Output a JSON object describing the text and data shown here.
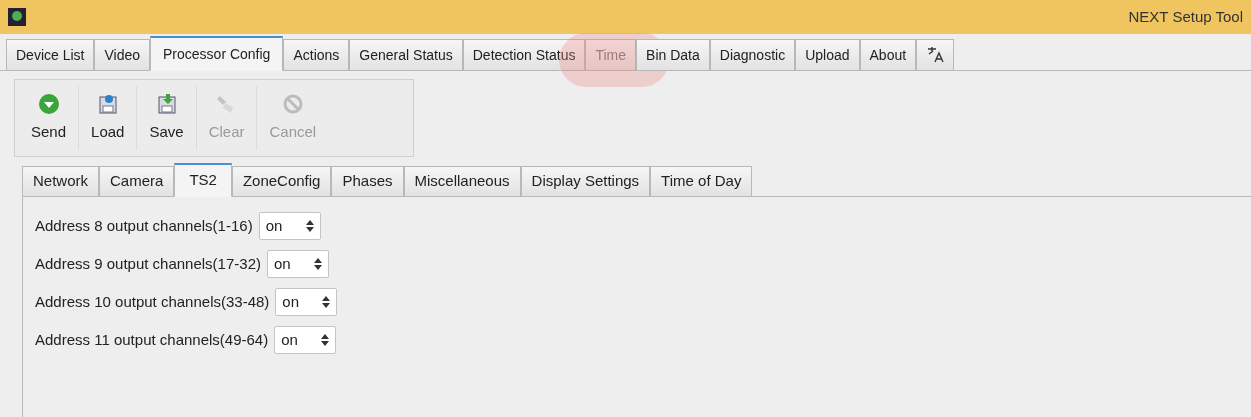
{
  "window": {
    "title": "NEXT Setup Tool"
  },
  "tabs": [
    {
      "label": "Device List",
      "selected": false,
      "disabled": false
    },
    {
      "label": "Video",
      "selected": false,
      "disabled": false
    },
    {
      "label": "Processor Config",
      "selected": true,
      "disabled": false
    },
    {
      "label": "Actions",
      "selected": false,
      "disabled": false
    },
    {
      "label": "General Status",
      "selected": false,
      "disabled": false
    },
    {
      "label": "Detection Status",
      "selected": false,
      "disabled": false
    },
    {
      "label": "Time",
      "selected": false,
      "disabled": true,
      "highlighted": true
    },
    {
      "label": "Bin Data",
      "selected": false,
      "disabled": false
    },
    {
      "label": "Diagnostic",
      "selected": false,
      "disabled": false
    },
    {
      "label": "Upload",
      "selected": false,
      "disabled": false
    },
    {
      "label": "About",
      "selected": false,
      "disabled": false
    },
    {
      "kind": "language",
      "selected": false,
      "disabled": false
    }
  ],
  "toolbar": [
    {
      "label": "Send",
      "kind": "send",
      "disabled": false
    },
    {
      "label": "Load",
      "kind": "load",
      "disabled": false
    },
    {
      "label": "Save",
      "kind": "save",
      "disabled": false
    },
    {
      "label": "Clear",
      "kind": "clear",
      "disabled": true
    },
    {
      "label": "Cancel",
      "kind": "cancel",
      "disabled": true
    }
  ],
  "subtabs": [
    {
      "label": "Network",
      "selected": false
    },
    {
      "label": "Camera",
      "selected": false
    },
    {
      "label": "TS2",
      "selected": true
    },
    {
      "label": "ZoneConfig",
      "selected": false
    },
    {
      "label": "Phases",
      "selected": false
    },
    {
      "label": "Miscellaneous",
      "selected": false
    },
    {
      "label": "Display Settings",
      "selected": false
    },
    {
      "label": "Time of Day",
      "selected": false
    }
  ],
  "settings": [
    {
      "label": "Address 8 output channels(1-16)",
      "value": "on"
    },
    {
      "label": "Address 9 output channels(17-32)",
      "value": "on"
    },
    {
      "label": "Address 10 output channels(33-48)",
      "value": "on"
    },
    {
      "label": "Address 11 output channels(49-64)",
      "value": "on"
    }
  ]
}
